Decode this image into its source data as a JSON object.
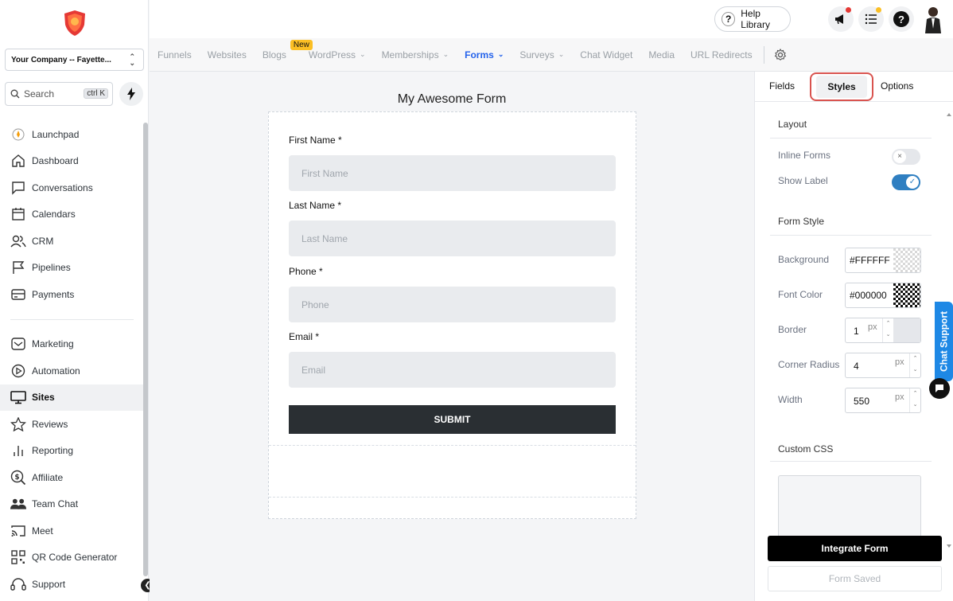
{
  "sidebar": {
    "company": "Your Company -- Fayette...",
    "search_label": "Search",
    "search_shortcut": "ctrl K",
    "items_top": [
      {
        "label": "Launchpad",
        "icon": "rocket-icon"
      },
      {
        "label": "Dashboard",
        "icon": "home-icon"
      },
      {
        "label": "Conversations",
        "icon": "chat-icon"
      },
      {
        "label": "Calendars",
        "icon": "calendar-icon"
      },
      {
        "label": "CRM",
        "icon": "users-icon"
      },
      {
        "label": "Pipelines",
        "icon": "flag-icon"
      },
      {
        "label": "Payments",
        "icon": "credit-card-icon"
      }
    ],
    "items_bottom": [
      {
        "label": "Marketing",
        "icon": "mail-icon"
      },
      {
        "label": "Automation",
        "icon": "play-icon"
      },
      {
        "label": "Sites",
        "icon": "monitor-icon",
        "active": true
      },
      {
        "label": "Reviews",
        "icon": "star-icon"
      },
      {
        "label": "Reporting",
        "icon": "bar-chart-icon"
      },
      {
        "label": "Affiliate",
        "icon": "dollar-search-icon"
      },
      {
        "label": "Team Chat",
        "icon": "team-icon"
      },
      {
        "label": "Meet",
        "icon": "cast-icon"
      },
      {
        "label": "QR Code Generator",
        "icon": "qr-icon"
      },
      {
        "label": "Support",
        "icon": "headset-icon"
      }
    ]
  },
  "topbar": {
    "help_library": "Help Library",
    "help_q": "?",
    "help_icon_q": "?",
    "notif_dot_color": "#e53935",
    "tasks_dot_color": "#fbbf24"
  },
  "subnav": {
    "tabs": [
      {
        "label": "Funnels"
      },
      {
        "label": "Websites"
      },
      {
        "label": "Blogs",
        "badge": "New"
      },
      {
        "label": "WordPress",
        "dropdown": true
      },
      {
        "label": "Memberships",
        "dropdown": true
      },
      {
        "label": "Forms",
        "dropdown": true,
        "active": true
      },
      {
        "label": "Surveys",
        "dropdown": true
      },
      {
        "label": "Chat Widget"
      },
      {
        "label": "Media"
      },
      {
        "label": "URL Redirects"
      }
    ]
  },
  "form": {
    "title": "My Awesome Form",
    "fields": [
      {
        "label": "First Name *",
        "placeholder": "First Name"
      },
      {
        "label": "Last Name *",
        "placeholder": "Last Name"
      },
      {
        "label": "Phone *",
        "placeholder": "Phone"
      },
      {
        "label": "Email *",
        "placeholder": "Email"
      }
    ],
    "submit": "SUBMIT"
  },
  "panel": {
    "tabs": {
      "fields": "Fields",
      "styles": "Styles",
      "options": "Options"
    },
    "layout_title": "Layout",
    "inline_forms": "Inline Forms",
    "inline_forms_on": false,
    "show_label": "Show Label",
    "show_label_on": true,
    "form_style_title": "Form Style",
    "background_label": "Background",
    "background_value": "#FFFFFF",
    "font_color_label": "Font Color",
    "font_color_value": "#000000",
    "border_label": "Border",
    "border_value": "1",
    "corner_radius_label": "Corner Radius",
    "corner_radius_value": "4",
    "width_label": "Width",
    "width_value": "550",
    "unit": "px",
    "custom_css_title": "Custom CSS",
    "integrate_button": "Integrate Form",
    "saved_button": "Form Saved"
  },
  "chat_support": "Chat Support",
  "colors": {
    "accent_blue": "#2563eb",
    "highlight_red": "#d9534f",
    "toggle_blue": "#2f7fc1"
  }
}
